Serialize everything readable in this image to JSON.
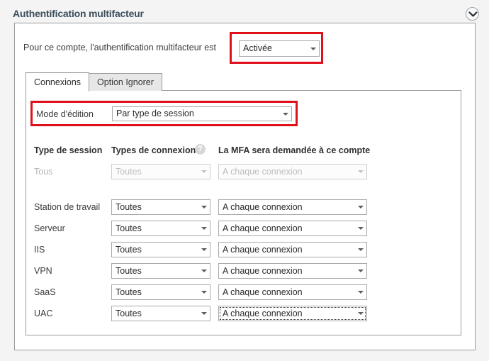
{
  "header": {
    "title": "Authentification multifacteur",
    "collapse_icon": "chevron-down-icon"
  },
  "account_state": {
    "label": "Pour ce compte, l'authentification multifacteur est",
    "value": "Activée",
    "highlight_color": "#e0101b"
  },
  "tabs": [
    {
      "label": "Connexions",
      "active": true
    },
    {
      "label": "Option Ignorer",
      "active": false
    }
  ],
  "edit_mode": {
    "label": "Mode d'édition",
    "value": "Par type de session",
    "highlight_color": "#e0101b"
  },
  "table": {
    "columns": [
      "Type de session",
      "Types de connexion",
      "La MFA sera demandée à ce compte"
    ],
    "help_icon": "?",
    "rows": [
      {
        "session_type": "Tous",
        "connection_types": "Toutes",
        "mfa_prompt": "A chaque connexion",
        "disabled": true,
        "focused": false
      },
      {
        "session_type": "Station de travail",
        "connection_types": "Toutes",
        "mfa_prompt": "A chaque connexion",
        "disabled": false,
        "focused": false
      },
      {
        "session_type": "Serveur",
        "connection_types": "Toutes",
        "mfa_prompt": "A chaque connexion",
        "disabled": false,
        "focused": false
      },
      {
        "session_type": "IIS",
        "connection_types": "Toutes",
        "mfa_prompt": "A chaque connexion",
        "disabled": false,
        "focused": false
      },
      {
        "session_type": "VPN",
        "connection_types": "Toutes",
        "mfa_prompt": "A chaque connexion",
        "disabled": false,
        "focused": false
      },
      {
        "session_type": "SaaS",
        "connection_types": "Toutes",
        "mfa_prompt": "A chaque connexion",
        "disabled": false,
        "focused": false
      },
      {
        "session_type": "UAC",
        "connection_types": "Toutes",
        "mfa_prompt": "A chaque connexion",
        "disabled": false,
        "focused": true
      }
    ]
  }
}
